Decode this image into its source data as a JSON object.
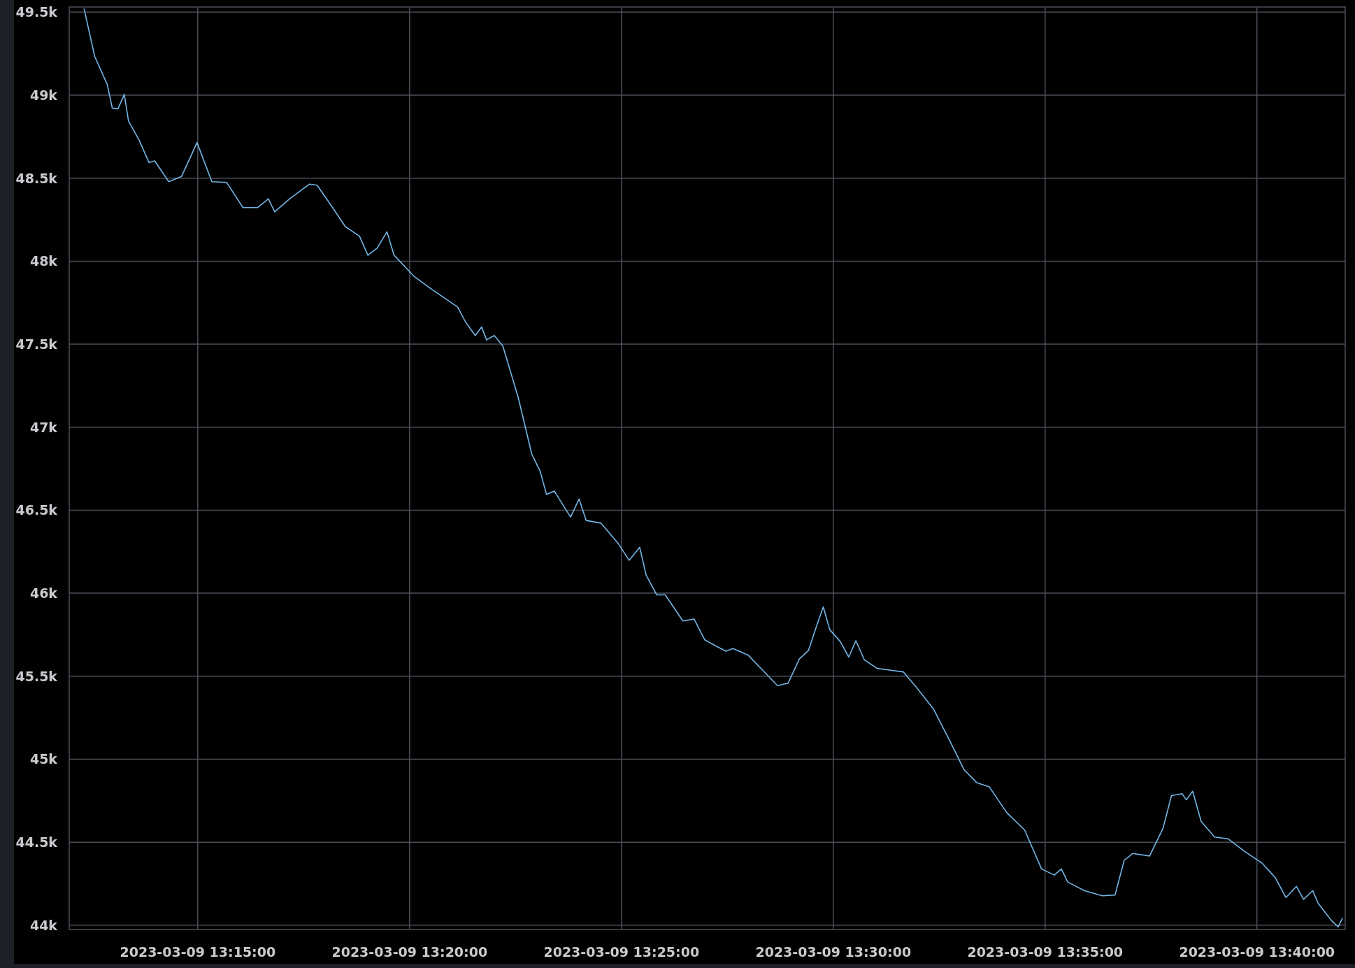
{
  "chart": {
    "chart_data": {
      "type": "line",
      "grid": true,
      "x": [
        "2023-03-09 13:12:19",
        "2023-03-09 13:12:34",
        "2023-03-09 13:12:52",
        "2023-03-09 13:12:59",
        "2023-03-09 13:13:07",
        "2023-03-09 13:13:16",
        "2023-03-09 13:13:22",
        "2023-03-09 13:13:37",
        "2023-03-09 13:13:51",
        "2023-03-09 13:13:59",
        "2023-03-09 13:14:19",
        "2023-03-09 13:14:37",
        "2023-03-09 13:14:59",
        "2023-03-09 13:15:20",
        "2023-03-09 13:15:41",
        "2023-03-09 13:16:04",
        "2023-03-09 13:16:25",
        "2023-03-09 13:16:40",
        "2023-03-09 13:16:49",
        "2023-03-09 13:17:10",
        "2023-03-09 13:17:38",
        "2023-03-09 13:17:49",
        "2023-03-09 13:18:11",
        "2023-03-09 13:18:29",
        "2023-03-09 13:18:49",
        "2023-03-09 13:19:01",
        "2023-03-09 13:19:14",
        "2023-03-09 13:19:28",
        "2023-03-09 13:19:38",
        "2023-03-09 13:20:07",
        "2023-03-09 13:20:32",
        "2023-03-09 13:21:08",
        "2023-03-09 13:21:19",
        "2023-03-09 13:21:33",
        "2023-03-09 13:21:42",
        "2023-03-09 13:21:49",
        "2023-03-09 13:22:00",
        "2023-03-09 13:22:12",
        "2023-03-09 13:22:34",
        "2023-03-09 13:22:53",
        "2023-03-09 13:23:05",
        "2023-03-09 13:23:14",
        "2023-03-09 13:23:25",
        "2023-03-09 13:23:48",
        "2023-03-09 13:24:00",
        "2023-03-09 13:24:10",
        "2023-03-09 13:24:31",
        "2023-03-09 13:24:55",
        "2023-03-09 13:25:11",
        "2023-03-09 13:25:26",
        "2023-03-09 13:25:35",
        "2023-03-09 13:25:50",
        "2023-03-09 13:26:02",
        "2023-03-09 13:26:27",
        "2023-03-09 13:26:43",
        "2023-03-09 13:26:58",
        "2023-03-09 13:27:16",
        "2023-03-09 13:27:28",
        "2023-03-09 13:27:38",
        "2023-03-09 13:28:00",
        "2023-03-09 13:28:20",
        "2023-03-09 13:28:41",
        "2023-03-09 13:28:56",
        "2023-03-09 13:29:12",
        "2023-03-09 13:29:25",
        "2023-03-09 13:29:38",
        "2023-03-09 13:29:46",
        "2023-03-09 13:29:55",
        "2023-03-09 13:30:10",
        "2023-03-09 13:30:22",
        "2023-03-09 13:30:32",
        "2023-03-09 13:30:44",
        "2023-03-09 13:31:02",
        "2023-03-09 13:31:39",
        "2023-03-09 13:31:58",
        "2023-03-09 13:32:22",
        "2023-03-09 13:32:47",
        "2023-03-09 13:33:05",
        "2023-03-09 13:33:23",
        "2023-03-09 13:33:41",
        "2023-03-09 13:34:06",
        "2023-03-09 13:34:31",
        "2023-03-09 13:34:55",
        "2023-03-09 13:35:13",
        "2023-03-09 13:35:23",
        "2023-03-09 13:35:32",
        "2023-03-09 13:35:56",
        "2023-03-09 13:36:21",
        "2023-03-09 13:36:39",
        "2023-03-09 13:36:52",
        "2023-03-09 13:37:04",
        "2023-03-09 13:37:28",
        "2023-03-09 13:37:47",
        "2023-03-09 13:37:59",
        "2023-03-09 13:38:14",
        "2023-03-09 13:38:20",
        "2023-03-09 13:38:29",
        "2023-03-09 13:38:41",
        "2023-03-09 13:39:00",
        "2023-03-09 13:39:19",
        "2023-03-09 13:39:43",
        "2023-03-09 13:40:07",
        "2023-03-09 13:40:26",
        "2023-03-09 13:40:41",
        "2023-03-09 13:40:56",
        "2023-03-09 13:41:06",
        "2023-03-09 13:41:19",
        "2023-03-09 13:41:27",
        "2023-03-09 13:41:46",
        "2023-03-09 13:41:55",
        "2023-03-09 13:42:01"
      ],
      "series": [
        {
          "color": "#73b6e6",
          "values": [
            49521,
            49234,
            49063,
            48922,
            48917,
            49005,
            48844,
            48729,
            48594,
            48604,
            48479,
            48510,
            48714,
            48479,
            48474,
            48323,
            48323,
            48375,
            48297,
            48375,
            48464,
            48458,
            48323,
            48208,
            48151,
            48036,
            48078,
            48177,
            48036,
            47906,
            47828,
            47724,
            47635,
            47552,
            47604,
            47526,
            47552,
            47490,
            47177,
            46839,
            46734,
            46594,
            46615,
            46458,
            46568,
            46438,
            46422,
            46302,
            46198,
            46276,
            46109,
            45990,
            45990,
            45833,
            45844,
            45719,
            45677,
            45651,
            45667,
            45625,
            45536,
            45443,
            45458,
            45604,
            45656,
            45823,
            45917,
            45781,
            45708,
            45615,
            45714,
            45599,
            45547,
            45526,
            45432,
            45302,
            45094,
            44938,
            44859,
            44833,
            44677,
            44573,
            44339,
            44302,
            44339,
            44260,
            44208,
            44177,
            44182,
            44391,
            44432,
            44417,
            44583,
            44781,
            44792,
            44755,
            44807,
            44625,
            44531,
            44521,
            44443,
            44375,
            44286,
            44167,
            44234,
            44156,
            44208,
            44130,
            44026,
            43990,
            44042
          ]
        }
      ],
      "xlim": [
        "2023-03-09 13:11:58",
        "2023-03-09 13:42:05"
      ],
      "ylim": [
        43974,
        49531
      ],
      "xticks": [
        "2023-03-09 13:15:00",
        "2023-03-09 13:20:00",
        "2023-03-09 13:25:00",
        "2023-03-09 13:30:00",
        "2023-03-09 13:35:00",
        "2023-03-09 13:40:00"
      ],
      "yticks": [
        {
          "value": 44000,
          "label": "44k"
        },
        {
          "value": 44500,
          "label": "44.5k"
        },
        {
          "value": 45000,
          "label": "45k"
        },
        {
          "value": 45500,
          "label": "45.5k"
        },
        {
          "value": 46000,
          "label": "46k"
        },
        {
          "value": 46500,
          "label": "46.5k"
        },
        {
          "value": 47000,
          "label": "47k"
        },
        {
          "value": 47500,
          "label": "47.5k"
        },
        {
          "value": 48000,
          "label": "48k"
        },
        {
          "value": 48500,
          "label": "48.5k"
        },
        {
          "value": 49000,
          "label": "49k"
        },
        {
          "value": 49500,
          "label": "49.5k"
        }
      ]
    }
  }
}
